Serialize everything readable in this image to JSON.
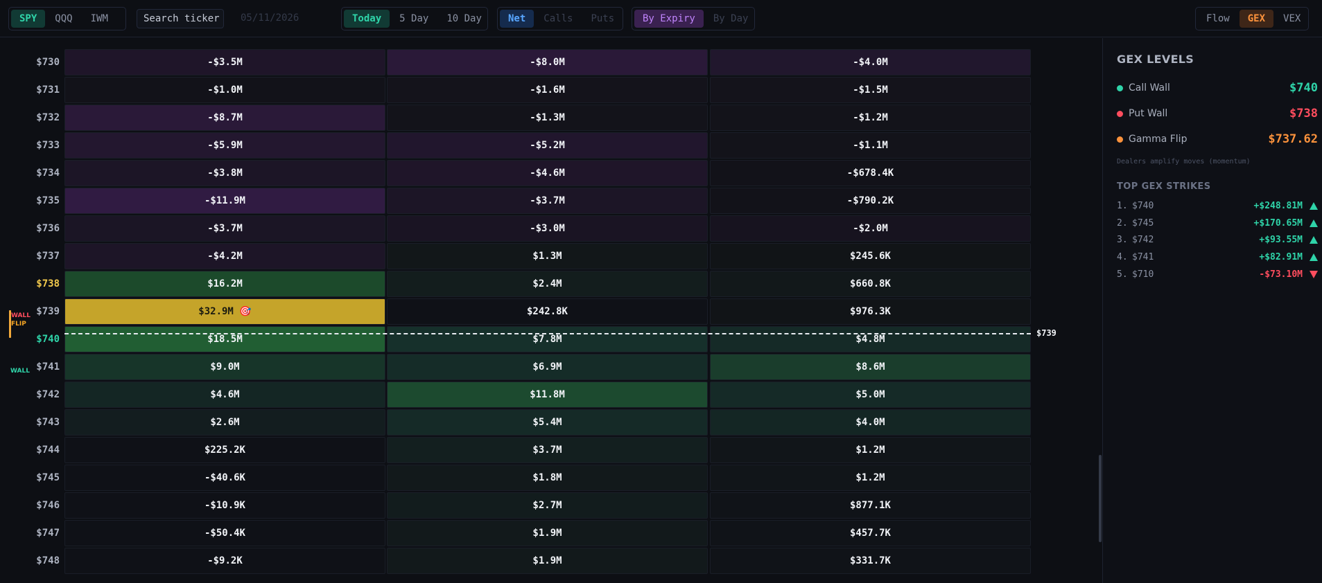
{
  "toolbar": {
    "tickers": [
      {
        "label": "SPY",
        "state": "active"
      },
      {
        "label": "QQQ",
        "state": "inactive"
      },
      {
        "label": "IWM",
        "state": "inactive"
      }
    ],
    "search_placeholder": "Search ticker",
    "date": "05/11/2026",
    "ranges": [
      {
        "label": "Today",
        "state": "active"
      },
      {
        "label": "5 Day",
        "state": "inactive"
      },
      {
        "label": "10 Day",
        "state": "inactive"
      }
    ],
    "greeks": [
      {
        "label": "Net",
        "state": "active"
      },
      {
        "label": "Calls",
        "state": "disabled"
      },
      {
        "label": "Puts",
        "state": "disabled"
      }
    ],
    "grouping": [
      {
        "label": "By Expiry",
        "state": "active"
      },
      {
        "label": "By Day",
        "state": "disabled"
      }
    ],
    "views": [
      {
        "label": "Flow",
        "state": "inactive"
      },
      {
        "label": "GEX",
        "state": "active"
      },
      {
        "label": "VEX",
        "state": "inactive"
      }
    ]
  },
  "grid": {
    "spot_label": "$739",
    "rows": [
      {
        "strike": "$730",
        "cells": [
          "-$3.5M",
          "-$8.0M",
          "-$4.0M"
        ]
      },
      {
        "strike": "$731",
        "cells": [
          "-$1.0M",
          "-$1.6M",
          "-$1.5M"
        ]
      },
      {
        "strike": "$732",
        "cells": [
          "-$8.7M",
          "-$1.3M",
          "-$1.2M"
        ]
      },
      {
        "strike": "$733",
        "cells": [
          "-$5.9M",
          "-$5.2M",
          "-$1.1M"
        ]
      },
      {
        "strike": "$734",
        "cells": [
          "-$3.8M",
          "-$4.6M",
          "-$678.4K"
        ]
      },
      {
        "strike": "$735",
        "cells": [
          "-$11.9M",
          "-$3.7M",
          "-$790.2K"
        ]
      },
      {
        "strike": "$736",
        "cells": [
          "-$3.7M",
          "-$3.0M",
          "-$2.0M"
        ]
      },
      {
        "strike": "$737",
        "cells": [
          "-$4.2M",
          "$1.3M",
          "$245.6K"
        ]
      },
      {
        "strike": "$738",
        "cells": [
          "$16.2M",
          "$2.4M",
          "$660.8K"
        ]
      },
      {
        "strike": "$739",
        "cells": [
          "$32.9M 🎯",
          "$242.8K",
          "$976.3K"
        ]
      },
      {
        "strike": "$740",
        "cells": [
          "$18.5M",
          "$7.8M",
          "$4.8M"
        ]
      },
      {
        "strike": "$741",
        "cells": [
          "$9.0M",
          "$6.9M",
          "$8.6M"
        ]
      },
      {
        "strike": "$742",
        "cells": [
          "$4.6M",
          "$11.8M",
          "$5.0M"
        ]
      },
      {
        "strike": "$743",
        "cells": [
          "$2.6M",
          "$5.4M",
          "$4.0M"
        ]
      },
      {
        "strike": "$744",
        "cells": [
          "$225.2K",
          "$3.7M",
          "$1.2M"
        ]
      },
      {
        "strike": "$745",
        "cells": [
          "-$40.6K",
          "$1.8M",
          "$1.2M"
        ]
      },
      {
        "strike": "$746",
        "cells": [
          "-$10.9K",
          "$2.7M",
          "$877.1K"
        ]
      },
      {
        "strike": "$747",
        "cells": [
          "-$50.4K",
          "$1.9M",
          "$457.7K"
        ]
      },
      {
        "strike": "$748",
        "cells": [
          "-$9.2K",
          "$1.9M",
          "$331.7K"
        ]
      }
    ],
    "tags": {
      "put_wall": "WALL",
      "flip": "FLIP",
      "call_wall": "WALL"
    }
  },
  "panel": {
    "title": "GEX LEVELS",
    "levels": [
      {
        "label": "Call Wall",
        "value": "$740",
        "color": "#2fd4a9"
      },
      {
        "label": "Put Wall",
        "value": "$738",
        "color": "#ff4d5e"
      },
      {
        "label": "Gamma Flip",
        "value": "$737.62",
        "color": "#fb923c"
      }
    ],
    "note": "Dealers amplify moves (momentum)",
    "top_title": "TOP GEX STRIKES",
    "top_strikes": [
      {
        "rank": "1.",
        "strike": "$740",
        "value": "+$248.81M",
        "direction": "up"
      },
      {
        "rank": "2.",
        "strike": "$745",
        "value": "+$170.65M",
        "direction": "up"
      },
      {
        "rank": "3.",
        "strike": "$742",
        "value": "+$93.55M",
        "direction": "up"
      },
      {
        "rank": "4.",
        "strike": "$741",
        "value": "+$82.91M",
        "direction": "up"
      },
      {
        "rank": "5.",
        "strike": "$710",
        "value": "-$73.10M",
        "direction": "down"
      }
    ]
  },
  "colors": {
    "positive": "#2fd4a9",
    "negative": "#ff4d5e",
    "spot_highlight": "#c5a42a",
    "call_wall_cell": "#215e33",
    "negative_cell_tint": "#2a1938"
  }
}
